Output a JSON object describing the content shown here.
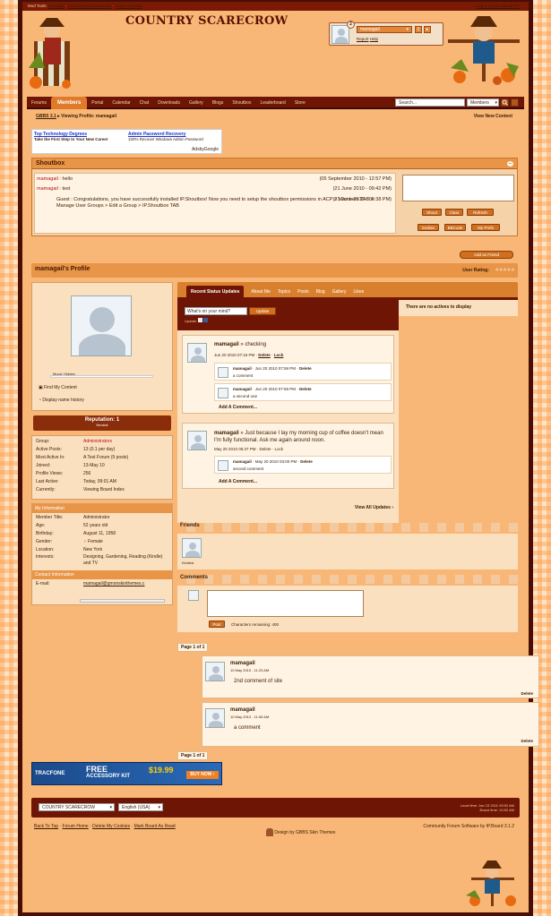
{
  "topbar": {
    "label": "Mod Tools:",
    "links": [
      "IP.Badge",
      "Forums Announcements",
      "Active Threads"
    ],
    "right": "Log in to your admin CP"
  },
  "site": {
    "title": "COUNTRY SCARECROW"
  },
  "user": {
    "name": "mamagail",
    "notifications": "2",
    "inbox": "1",
    "links": [
      "Report",
      "Help"
    ]
  },
  "nav": [
    "Forums",
    "Members",
    "Portal",
    "Calendar",
    "Chat",
    "Downloads",
    "Gallery",
    "Blogs",
    "Shoutbox",
    "Leaderboard",
    "Store"
  ],
  "search": {
    "placeholder": "Search...",
    "scope": "Members"
  },
  "crumb": {
    "home": "GBBS 3.1",
    "current": "Viewing Profile: mamagail",
    "viewnew": "View New Content"
  },
  "ad": {
    "t1": "Top Technology Degrees",
    "l1": "Take the First Step to Your New Career",
    "t2": "Admin Password Recovery",
    "l2": "100% Recover Windows Admin Password",
    "provider": "AdsbyGoogle"
  },
  "shoutbox": {
    "title": "Shoutbox",
    "msgs": [
      {
        "user": "mamagail",
        "text": "hello",
        "time": "(05 September 2010 - 12:57 PM)"
      },
      {
        "user": "mamagail",
        "text": "test",
        "time": "(21 June 2010 - 09:42 PM)"
      },
      {
        "user": "Guest",
        "text": "Congratulations, you have successfully installed IP.Shoutbox! Now you need to setup the shoutbox permissions in ACP > Members TAB > Manage User Groups > Edit a Group > IP.Shoutbox TAB",
        "time": "(21 June 2010 - 08:38 PM)"
      }
    ],
    "b1": "Shout",
    "b2": "Clear",
    "b3": "Refresh",
    "b4": "Smilies",
    "b5": "BBCode",
    "b6": "My Prefs"
  },
  "profile": {
    "add_friend": "Add as Friend",
    "title": "mamagail's Profile",
    "rating_label": "User Rating:",
    "mood_label": "Mood: Hidden",
    "find_content": "Find My Content",
    "name_history": "Display name history",
    "reputation": "Reputation: 1",
    "reputation_label": "Neutral"
  },
  "info": [
    {
      "k": "Group:",
      "v": "Administrators"
    },
    {
      "k": "Active Posts:",
      "v": "13 (0.1 per day)"
    },
    {
      "k": "Most Active In:",
      "v": "A Test Forum (9 posts)"
    },
    {
      "k": "Joined:",
      "v": "13-May 10"
    },
    {
      "k": "Profile Views:",
      "v": "256"
    },
    {
      "k": "Last Active:",
      "v": "Today, 09:01 AM"
    },
    {
      "k": "Currently:",
      "v": "Viewing Board Index"
    }
  ],
  "myinfo": {
    "title": "My Information",
    "rows": [
      {
        "k": "Member Title:",
        "v": "Administrator"
      },
      {
        "k": "Age:",
        "v": "52 years old"
      },
      {
        "k": "Birthday:",
        "v": "August 11, 1958"
      },
      {
        "k": "Gender:",
        "v": "Female"
      },
      {
        "k": "Location:",
        "v": "New York"
      },
      {
        "k": "Interests:",
        "v": "Designing, Gardening, Reading (Kindle) and TV"
      }
    ]
  },
  "contact": {
    "title": "Contact Information",
    "k": "E-mail:",
    "v": "mamagail@gmonskinthemes.c"
  },
  "tabs": [
    "Recent Status Updates",
    "About Me",
    "Topics",
    "Posts",
    "Blog",
    "Gallery",
    "Likes"
  ],
  "status": {
    "placeholder": "What's on your mind?",
    "button": "Update",
    "share": "Update:",
    "no_activity": "There are no actives to display"
  },
  "feed": {
    "add_comment": "Add A Comment...",
    "view_all": "View All Updates ›",
    "0": {
      "user": "mamagail",
      "text": "checking",
      "time": "Jun 20 2010 07:16 PM",
      "del": "Delete",
      "lock": "Lock",
      "replies": [
        {
          "user": "mamagail",
          "time": "Jun 20 2010 07:59 PM",
          "text": "a comment"
        },
        {
          "user": "mamagail",
          "time": "Jun 20 2010 07:59 PM",
          "text": "a second one"
        }
      ]
    },
    "1": {
      "user": "mamagail",
      "text": "Just because I lay my morning cup of coffee doesn't mean I'm fully functional. Ask me again around noon.",
      "time": "May 20 2010 05:37 PM · Delete · Lock",
      "replies": [
        {
          "user": "mamagail",
          "time": "May 20 2010 03:00 PM",
          "text": "second comment"
        }
      ]
    }
  },
  "friends": {
    "title": "Friends",
    "name": "Kimtest"
  },
  "comments": {
    "title": "Comments",
    "post": "Post",
    "remaining": "Characters remaining: 400",
    "page": "Page 1 of 1",
    "delete": "Delete",
    "items": [
      {
        "user": "mamagail",
        "time": "10 May 2010 - 11:23 AM",
        "text": "2nd comment of site"
      },
      {
        "user": "mamagail",
        "time": "10 May 2010 - 11:06 AM",
        "text": "a comment"
      }
    ]
  },
  "ad2": {
    "brand": "TRACFONE",
    "headline": "FREE",
    "sub": "ACCESSORY KIT",
    "price": "$19.99",
    "cta": "BUY NOW ›"
  },
  "footer": {
    "skin": "COUNTRY SCARECROW",
    "lang": "English (USA)",
    "time1": "Local time: Jan 13 2011 09:52 AM",
    "time2": "Board time: 10:52 AM",
    "links": [
      "Back To Top",
      "Forum Home",
      "Delete My Cookies",
      "Mark Board As Read"
    ],
    "credit": "Design by GBBS Skin Themes",
    "software": "Community Forum Software by IP.Board 3.1.2"
  }
}
